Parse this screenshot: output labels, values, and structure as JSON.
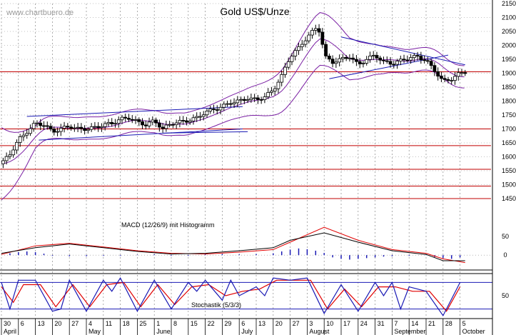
{
  "chart_data": {
    "type": "candlestick",
    "title": "Gold US$/Unze",
    "watermark": "www.chartbuero.de",
    "colors": {
      "candle": "#000000",
      "ma_band": "#7a1fa3",
      "horizontal_lines": "#c00000",
      "trend_lines": "#1a1ab4",
      "macd_line": "#000000",
      "signal_line": "#e00000",
      "histogram": "#1a1ab4",
      "stoch_k": "#1a1ab4",
      "stoch_d": "#e00000",
      "grid": "#888888"
    },
    "price_axis": {
      "ylim": [
        1450,
        2150
      ],
      "ticks": [
        2150,
        2100,
        2050,
        2000,
        1950,
        1900,
        1850,
        1800,
        1750,
        1700,
        1650,
        1600,
        1550,
        1500,
        1450
      ]
    },
    "horizontal_levels": [
      1905,
      1700,
      1640,
      1555,
      1495,
      1450
    ],
    "x_axis": {
      "day_labels": [
        "30",
        "6",
        "13",
        "20",
        "27",
        "4",
        "11",
        "18",
        "25",
        "1",
        "8",
        "15",
        "22",
        "29",
        "6",
        "13",
        "20",
        "27",
        "3",
        "10",
        "17",
        "24",
        "31",
        "7",
        "14",
        "21",
        "28",
        "5"
      ],
      "month_labels": [
        {
          "label": "April",
          "week": 0
        },
        {
          "label": "May",
          "week": 5
        },
        {
          "label": "June",
          "week": 9
        },
        {
          "label": "July",
          "week": 14
        },
        {
          "label": "August",
          "week": 18
        },
        {
          "label": "September",
          "week": 23
        },
        {
          "label": "October",
          "week": 27
        }
      ]
    },
    "price_series": [
      {
        "week": 0.0,
        "close": 1575
      },
      {
        "week": 0.5,
        "close": 1610
      },
      {
        "week": 1.0,
        "close": 1660
      },
      {
        "week": 1.5,
        "close": 1690
      },
      {
        "week": 2.0,
        "close": 1720
      },
      {
        "week": 2.5,
        "close": 1715
      },
      {
        "week": 3.0,
        "close": 1690
      },
      {
        "week": 3.5,
        "close": 1700
      },
      {
        "week": 4.0,
        "close": 1710
      },
      {
        "week": 4.5,
        "close": 1700
      },
      {
        "week": 5.0,
        "close": 1700
      },
      {
        "week": 5.5,
        "close": 1705
      },
      {
        "week": 6.0,
        "close": 1715
      },
      {
        "week": 6.5,
        "close": 1720
      },
      {
        "week": 7.0,
        "close": 1735
      },
      {
        "week": 7.5,
        "close": 1740
      },
      {
        "week": 8.0,
        "close": 1725
      },
      {
        "week": 8.5,
        "close": 1715
      },
      {
        "week": 9.0,
        "close": 1730
      },
      {
        "week": 9.5,
        "close": 1700
      },
      {
        "week": 10.0,
        "close": 1720
      },
      {
        "week": 10.5,
        "close": 1725
      },
      {
        "week": 11.0,
        "close": 1730
      },
      {
        "week": 11.5,
        "close": 1740
      },
      {
        "week": 12.0,
        "close": 1760
      },
      {
        "week": 12.5,
        "close": 1770
      },
      {
        "week": 13.0,
        "close": 1780
      },
      {
        "week": 13.5,
        "close": 1795
      },
      {
        "week": 14.0,
        "close": 1800
      },
      {
        "week": 14.5,
        "close": 1810
      },
      {
        "week": 15.0,
        "close": 1805
      },
      {
        "week": 15.5,
        "close": 1815
      },
      {
        "week": 16.0,
        "close": 1840
      },
      {
        "week": 16.5,
        "close": 1890
      },
      {
        "week": 17.0,
        "close": 1960
      },
      {
        "week": 17.5,
        "close": 1990
      },
      {
        "week": 18.0,
        "close": 2030
      },
      {
        "week": 18.5,
        "close": 2060
      },
      {
        "week": 18.8,
        "close": 2050
      },
      {
        "week": 19.0,
        "close": 1960
      },
      {
        "week": 19.5,
        "close": 1940
      },
      {
        "week": 20.0,
        "close": 1950
      },
      {
        "week": 20.5,
        "close": 1960
      },
      {
        "week": 21.0,
        "close": 1930
      },
      {
        "week": 21.5,
        "close": 1950
      },
      {
        "week": 22.0,
        "close": 1965
      },
      {
        "week": 22.5,
        "close": 1940
      },
      {
        "week": 23.0,
        "close": 1935
      },
      {
        "week": 23.5,
        "close": 1945
      },
      {
        "week": 24.0,
        "close": 1955
      },
      {
        "week": 24.5,
        "close": 1960
      },
      {
        "week": 25.0,
        "close": 1945
      },
      {
        "week": 25.5,
        "close": 1910
      },
      {
        "week": 26.0,
        "close": 1870
      },
      {
        "week": 26.5,
        "close": 1880
      },
      {
        "week": 27.0,
        "close": 1900
      },
      {
        "week": 27.3,
        "close": 1905
      }
    ],
    "macd": {
      "label": "MACD (12/26/9) mit Histogramm",
      "ticks": [
        50,
        0
      ],
      "ylim": [
        -40,
        110
      ],
      "macd_line": [
        {
          "week": 0,
          "v": 5
        },
        {
          "week": 2,
          "v": 20
        },
        {
          "week": 4,
          "v": 30
        },
        {
          "week": 6,
          "v": 20
        },
        {
          "week": 8,
          "v": 10
        },
        {
          "week": 10,
          "v": 3
        },
        {
          "week": 12,
          "v": 5
        },
        {
          "week": 14,
          "v": 12
        },
        {
          "week": 16,
          "v": 20
        },
        {
          "week": 17,
          "v": 40
        },
        {
          "week": 19,
          "v": 60
        },
        {
          "week": 21,
          "v": 35
        },
        {
          "week": 23,
          "v": 12
        },
        {
          "week": 25,
          "v": 2
        },
        {
          "week": 26,
          "v": -15
        },
        {
          "week": 27.3,
          "v": -15
        }
      ],
      "signal_line": [
        {
          "week": 0,
          "v": 2
        },
        {
          "week": 2,
          "v": 25
        },
        {
          "week": 4,
          "v": 32
        },
        {
          "week": 6,
          "v": 22
        },
        {
          "week": 8,
          "v": 12
        },
        {
          "week": 10,
          "v": 5
        },
        {
          "week": 12,
          "v": 3
        },
        {
          "week": 14,
          "v": 8
        },
        {
          "week": 16,
          "v": 15
        },
        {
          "week": 17,
          "v": 35
        },
        {
          "week": 19,
          "v": 75
        },
        {
          "week": 21,
          "v": 40
        },
        {
          "week": 23,
          "v": 15
        },
        {
          "week": 25,
          "v": 5
        },
        {
          "week": 26,
          "v": -10
        },
        {
          "week": 27.3,
          "v": -20
        }
      ],
      "histogram": [
        {
          "week": 0.5,
          "v": 5
        },
        {
          "week": 1,
          "v": 8
        },
        {
          "week": 1.5,
          "v": 10
        },
        {
          "week": 2,
          "v": 8
        },
        {
          "week": 2.5,
          "v": 4
        },
        {
          "week": 3,
          "v": -2
        },
        {
          "week": 4,
          "v": -3
        },
        {
          "week": 5,
          "v": -3
        },
        {
          "week": 6,
          "v": -2
        },
        {
          "week": 7,
          "v": -2
        },
        {
          "week": 8,
          "v": 1
        },
        {
          "week": 9,
          "v": 2
        },
        {
          "week": 10,
          "v": -2
        },
        {
          "week": 11,
          "v": -2
        },
        {
          "week": 12,
          "v": 2
        },
        {
          "week": 13,
          "v": 3
        },
        {
          "week": 14,
          "v": 2
        },
        {
          "week": 15,
          "v": 3
        },
        {
          "week": 16,
          "v": 5
        },
        {
          "week": 16.5,
          "v": 10
        },
        {
          "week": 17,
          "v": 15
        },
        {
          "week": 17.5,
          "v": 18
        },
        {
          "week": 18,
          "v": 16
        },
        {
          "week": 18.5,
          "v": 12
        },
        {
          "week": 19,
          "v": 6
        },
        {
          "week": 19.5,
          "v": -6
        },
        {
          "week": 20,
          "v": -10
        },
        {
          "week": 20.5,
          "v": -12
        },
        {
          "week": 21,
          "v": -10
        },
        {
          "week": 21.5,
          "v": -8
        },
        {
          "week": 22,
          "v": -6
        },
        {
          "week": 22.5,
          "v": -4
        },
        {
          "week": 23,
          "v": -3
        },
        {
          "week": 24,
          "v": -2
        },
        {
          "week": 25,
          "v": 2
        },
        {
          "week": 25.5,
          "v": -5
        },
        {
          "week": 26,
          "v": -8
        },
        {
          "week": 26.5,
          "v": -10
        },
        {
          "week": 27,
          "v": -6
        }
      ]
    },
    "stochastic": {
      "label": "Stochastik (5/3/3)",
      "ticks": [
        50
      ],
      "ylim": [
        0,
        100
      ],
      "k_line": [
        {
          "week": 0,
          "v": 80
        },
        {
          "week": 0.5,
          "v": 20
        },
        {
          "week": 1,
          "v": 85
        },
        {
          "week": 2,
          "v": 85
        },
        {
          "week": 3,
          "v": 15
        },
        {
          "week": 3.5,
          "v": 20
        },
        {
          "week": 4,
          "v": 85
        },
        {
          "week": 5,
          "v": 15
        },
        {
          "week": 6,
          "v": 85
        },
        {
          "week": 6.5,
          "v": 60
        },
        {
          "week": 7,
          "v": 90
        },
        {
          "week": 8,
          "v": 15
        },
        {
          "week": 9,
          "v": 85
        },
        {
          "week": 10,
          "v": 20
        },
        {
          "week": 11,
          "v": 80
        },
        {
          "week": 11.5,
          "v": 60
        },
        {
          "week": 12,
          "v": 85
        },
        {
          "week": 13,
          "v": 40
        },
        {
          "week": 13.5,
          "v": 85
        },
        {
          "week": 14,
          "v": 50
        },
        {
          "week": 15,
          "v": 70
        },
        {
          "week": 15.5,
          "v": 50
        },
        {
          "week": 16,
          "v": 90
        },
        {
          "week": 17,
          "v": 85
        },
        {
          "week": 18,
          "v": 90
        },
        {
          "week": 19,
          "v": 10
        },
        {
          "week": 20,
          "v": 75
        },
        {
          "week": 21,
          "v": 15
        },
        {
          "week": 22,
          "v": 80
        },
        {
          "week": 22.5,
          "v": 50
        },
        {
          "week": 23,
          "v": 80
        },
        {
          "week": 23.5,
          "v": 20
        },
        {
          "week": 24,
          "v": 70
        },
        {
          "week": 25,
          "v": 60
        },
        {
          "week": 26,
          "v": 5
        },
        {
          "week": 27,
          "v": 80
        }
      ],
      "d_line": [
        {
          "week": 0,
          "v": 70
        },
        {
          "week": 0.7,
          "v": 35
        },
        {
          "week": 1.3,
          "v": 75
        },
        {
          "week": 2.3,
          "v": 75
        },
        {
          "week": 3.2,
          "v": 25
        },
        {
          "week": 4.2,
          "v": 75
        },
        {
          "week": 5.2,
          "v": 25
        },
        {
          "week": 6.2,
          "v": 75
        },
        {
          "week": 7.2,
          "v": 80
        },
        {
          "week": 8.2,
          "v": 25
        },
        {
          "week": 9.2,
          "v": 75
        },
        {
          "week": 10.2,
          "v": 30
        },
        {
          "week": 11.2,
          "v": 70
        },
        {
          "week": 12.2,
          "v": 75
        },
        {
          "week": 13.2,
          "v": 50
        },
        {
          "week": 14.2,
          "v": 60
        },
        {
          "week": 15.2,
          "v": 65
        },
        {
          "week": 16.2,
          "v": 85
        },
        {
          "week": 17.2,
          "v": 85
        },
        {
          "week": 18.2,
          "v": 85
        },
        {
          "week": 19.2,
          "v": 20
        },
        {
          "week": 20.2,
          "v": 65
        },
        {
          "week": 21.2,
          "v": 25
        },
        {
          "week": 22.2,
          "v": 70
        },
        {
          "week": 23.2,
          "v": 70
        },
        {
          "week": 24.2,
          "v": 60
        },
        {
          "week": 25.2,
          "v": 60
        },
        {
          "week": 26.2,
          "v": 15
        },
        {
          "week": 27,
          "v": 70
        }
      ]
    }
  }
}
